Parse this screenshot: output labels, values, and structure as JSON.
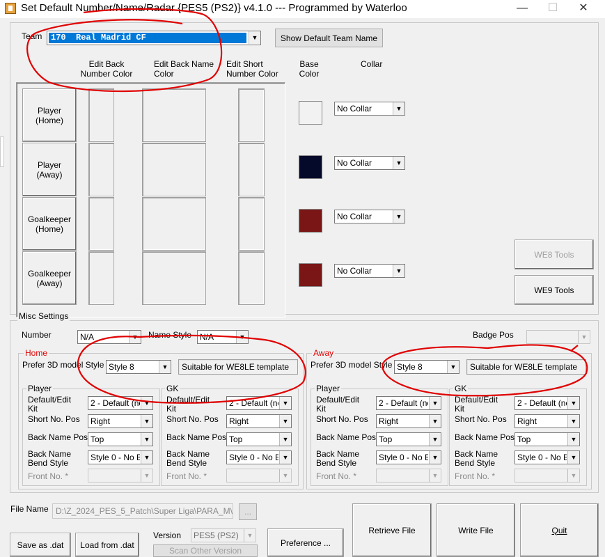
{
  "window": {
    "title": "Set Default Number/Name/Radar {PES5 (PS2)} v4.1.0 --- Programmed by Waterloo",
    "minimize": "—",
    "maximize": "☐",
    "close": "✕"
  },
  "team": {
    "label": "Team",
    "value": "170  Real Madrid CF",
    "show_default_button": "Show Default Team Name"
  },
  "columns": {
    "back_number_color": "Edit Back\nNumber Color",
    "back_name_color": "Edit Back Name\nColor",
    "short_number_color": "Edit Short\nNumber Color",
    "base_color": "Base\nColor",
    "collar": "Collar"
  },
  "kits": [
    {
      "label": "Player\n(Home)",
      "base_color": "#f2f2f2",
      "collar": "No Collar"
    },
    {
      "label": "Player\n(Away)",
      "base_color": "#060a2a",
      "collar": "No Collar"
    },
    {
      "label": "Goalkeeper\n(Home)",
      "base_color": "#7a1616",
      "collar": "No Collar"
    },
    {
      "label": "Goalkeeper\n(Away)",
      "base_color": "#7a1616",
      "collar": "No Collar"
    }
  ],
  "tools": {
    "we8": "WE8 Tools",
    "we9": "WE9 Tools"
  },
  "misc": {
    "title": "Misc Settings",
    "number_label": "Number",
    "number_value": "N/A",
    "name_style_label": "Name Style",
    "name_style_value": "N/A",
    "badge_pos_label": "Badge Pos",
    "badge_pos_value": ""
  },
  "home": {
    "title": "Home",
    "prefer_label": "Prefer 3D model Style",
    "style_value": "Style 8",
    "template_text": "Suitable for WE8LE template",
    "player_title": "Player",
    "gk_title": "GK",
    "player": {
      "default_edit_label": "Default/Edit\nKit",
      "default_edit_value": "2 - Default (no",
      "short_no_pos_label": "Short No. Pos",
      "short_no_pos_value": "Right",
      "back_name_pos_label": "Back Name Pos",
      "back_name_pos_value": "Top",
      "bend_label": "Back Name\nBend Style",
      "bend_value": "Style 0 - No B",
      "front_no_label": "Front No. *",
      "front_no_value": ""
    },
    "gk": {
      "default_edit_label": "Default/Edit\nKit",
      "default_edit_value": "2 - Default (no",
      "short_no_pos_label": "Short No. Pos",
      "short_no_pos_value": "Right",
      "back_name_pos_label": "Back Name Pos",
      "back_name_pos_value": "Top",
      "bend_label": "Back Name\nBend Style",
      "bend_value": "Style 0 - No B",
      "front_no_label": "Front No. *",
      "front_no_value": ""
    }
  },
  "away": {
    "title": "Away",
    "prefer_label": "Prefer 3D model Style",
    "style_value": "Style 8",
    "template_text": "Suitable for WE8LE template",
    "player_title": "Player",
    "gk_title": "GK",
    "player": {
      "default_edit_label": "Default/Edit\nKit",
      "default_edit_value": "2 - Default (no",
      "short_no_pos_label": "Short No. Pos",
      "short_no_pos_value": "Right",
      "back_name_pos_label": "Back Name Pos",
      "back_name_pos_value": "Top",
      "bend_label": "Back Name\nBend Style",
      "bend_value": "Style 0 - No B",
      "front_no_label": "Front No. *",
      "front_no_value": ""
    },
    "gk": {
      "default_edit_label": "Default/Edit\nKit",
      "default_edit_value": "2 - Default (no",
      "short_no_pos_label": "Short No. Pos",
      "short_no_pos_value": "Right",
      "back_name_pos_label": "Back Name Pos",
      "back_name_pos_value": "Top",
      "bend_label": "Back Name\nBend Style",
      "bend_value": "Style 0 - No B",
      "front_no_label": "Front No. *",
      "front_no_value": ""
    }
  },
  "file": {
    "label": "File Name",
    "path": "D:\\Z_2024_PES_5_Patch\\Super Liga\\PARA_M\\",
    "browse": "...",
    "save_as": "Save as .dat",
    "load_from": "Load from .dat",
    "version_label": "Version",
    "version_value": "PES5 (PS2)",
    "scan_other": "Scan Other Version",
    "preference": "Preference ...",
    "retrieve": "Retrieve File",
    "write": "Write File",
    "quit": "Quit"
  },
  "annotation_color": "#e00000"
}
